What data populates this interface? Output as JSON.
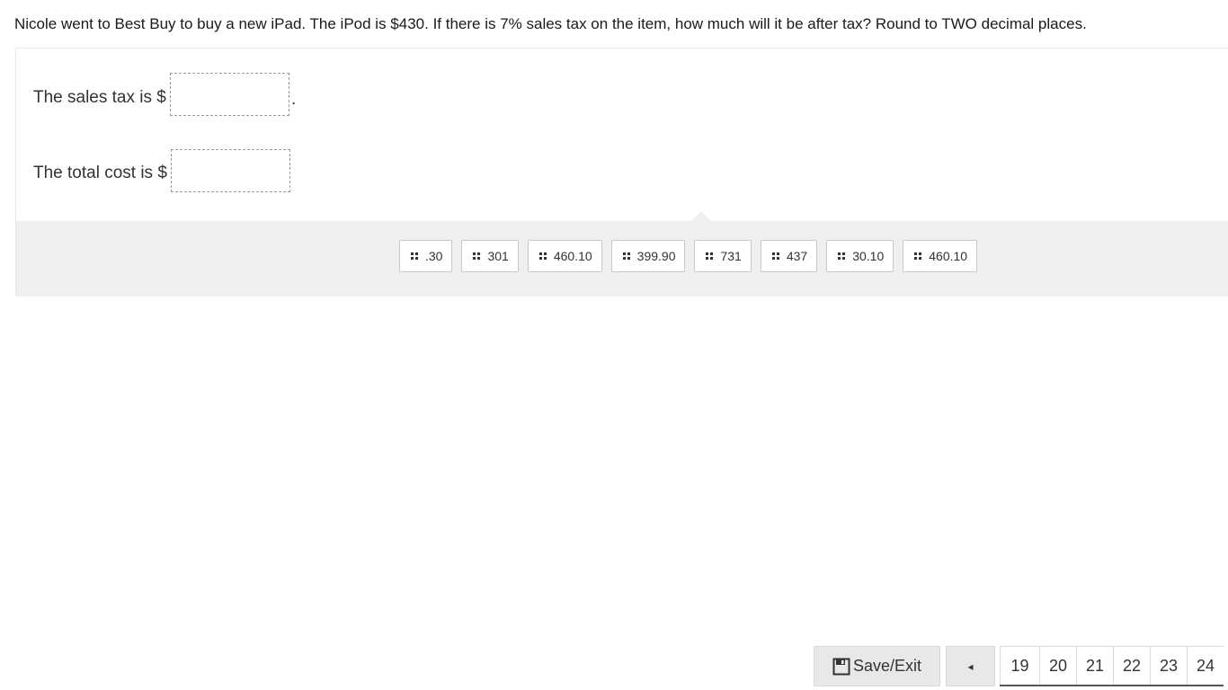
{
  "question": {
    "text": "Nicole went to Best Buy to buy a new iPad. The iPod is $430. If there is 7% sales tax on the item, how much will it be after tax? Round to TWO decimal places."
  },
  "prompts": {
    "sales_tax": "The sales tax is $",
    "total_cost": "The total cost is $",
    "period": "."
  },
  "tokens": [
    ".30",
    "301",
    "460.10",
    "399.90",
    "731",
    "437",
    "30.10",
    "460.10"
  ],
  "footer": {
    "save_label": "Save/Exit",
    "prev_icon": "◂",
    "pages": [
      "19",
      "20",
      "21",
      "22",
      "23",
      "24"
    ]
  }
}
